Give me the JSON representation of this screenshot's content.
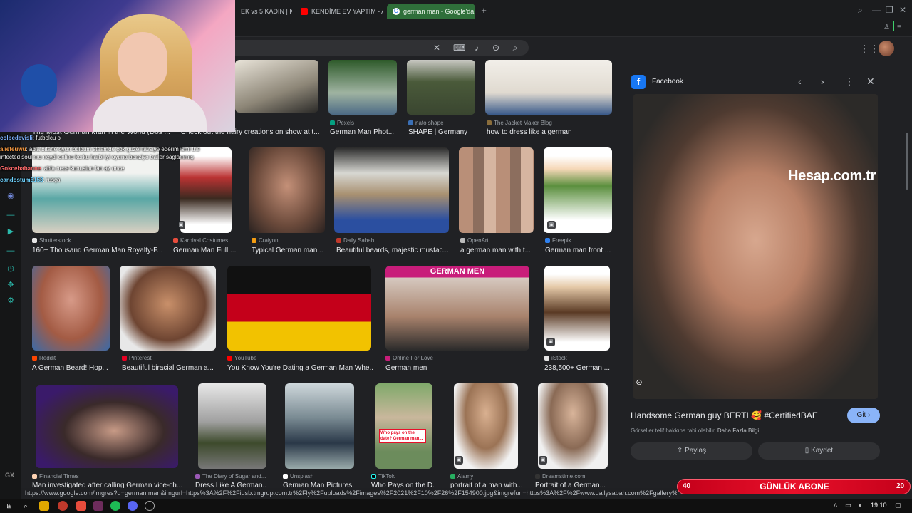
{
  "browser": {
    "tabs": [
      {
        "label": "EK vs 5 KADIN | KIY",
        "icon": "tab-icon"
      },
      {
        "label": "KENDİME EV YAPTIM - A",
        "icon": "youtube-icon"
      },
      {
        "label": "german man - Google'da",
        "icon": "google-icon",
        "active": true
      }
    ],
    "new_tab": "+"
  },
  "search": {
    "clear": "✕",
    "keyboard": "⌨",
    "mic": "🎤",
    "lens": "⊙",
    "search": "⌕"
  },
  "results": {
    "row0": [
      {
        "source": "",
        "caption": "The Most German Man in the World (Dos ..."
      },
      {
        "source": "",
        "caption": "Check out the hairy creations on show at t..."
      },
      {
        "source": "Pexels",
        "caption": "German Man Phot..."
      },
      {
        "source": "nato shape",
        "caption": "SHAPE | Germany"
      },
      {
        "source": "The Jacket Maker Blog",
        "caption": "how to dress like a german"
      }
    ],
    "row1": [
      {
        "source": "Shutterstock",
        "caption": "160+ Thousand German Man Royalty-F..."
      },
      {
        "source": "Karnival Costumes",
        "caption": "German Man Full ..."
      },
      {
        "source": "Craiyon",
        "caption": "Typical German man..."
      },
      {
        "source": "Daily Sabah",
        "caption": "Beautiful beards, majestic mustac..."
      },
      {
        "source": "OpenArt",
        "caption": "a german man with t..."
      },
      {
        "source": "Freepik",
        "caption": "German man front ..."
      }
    ],
    "row2": [
      {
        "source": "Reddit",
        "caption": "A German Beard! Hop..."
      },
      {
        "source": "Pinterest",
        "caption": "Beautiful biracial German a..."
      },
      {
        "source": "YouTube",
        "caption": "You Know You're Dating a German Man Whe..."
      },
      {
        "source": "Online For Love",
        "caption": "German men"
      },
      {
        "source": "iStock",
        "caption": "238,500+ German ..."
      }
    ],
    "row3": [
      {
        "source": "Financial Times",
        "caption": "Man investigated after calling German vice-ch..."
      },
      {
        "source": "The Diary of Sugar and...",
        "caption": "Dress Like A German..."
      },
      {
        "source": "Unsplash",
        "caption": "German Man Pictures..."
      },
      {
        "source": "TikTok",
        "caption": "Who Pays on the D..."
      },
      {
        "source": "Alamy",
        "caption": "portrait of a man with..."
      },
      {
        "source": "Dreamstime.com",
        "caption": "Portrait of a German..."
      }
    ],
    "banner_text": "GERMAN MEN",
    "tiktok_overlay": "Who pays on the date? German man..."
  },
  "preview": {
    "source": "Facebook",
    "watermark": "Hesap.com.tr",
    "title": "Handsome German guy BERTI 🥰 #CertifiedBAE",
    "visit": "Git",
    "copyright": "Görseller telif hakkına tabi olabilir.",
    "learn_more": "Daha Fazla Bilgi",
    "share": "Paylaş",
    "save": "Kaydet"
  },
  "chat": [
    {
      "user": "colbedevisli",
      "msg": ": futbolcu o",
      "color": "#7fb4ff"
    },
    {
      "user": "aliefeuwu",
      "msg": ": abla bitane oyun buldum steamde çok güzel tavsiye ederim ismi the",
      "color": "#ff9f43"
    },
    {
      "user": "",
      "msg": "infected soul mu neydi online korku harbi iyi oyuna benziyo trailer sağlammış",
      "color": "#ffffff"
    },
    {
      "user": "Gokcebabanne",
      "msg": ": abla nece konustun lan az once",
      "color": "#ff6b6b"
    },
    {
      "user": "candostum6153",
      "msg": ": rusça",
      "color": "#6fd3ff"
    }
  ],
  "overlay": {
    "sub_left": "40",
    "sub_label": "GÜNLÜK ABONE",
    "sub_right": "20"
  },
  "status_url": "https://www.google.com/imgres?q=german man&imgurl=https%3A%2F%2Fidsb.tmgrup.com.tr%2Fly%2Fuploads%2Fimages%2F2021%2F10%2F26%2F154900.jpg&imgrefurl=https%3A%2F%2Fwww.dailysabah.com%2Fgallery%2Fbeautiful-beards-majestic-mustaches-compete-at-german-event",
  "taskbar": {
    "time": "19:10",
    "gx": "GX"
  },
  "colors": {
    "accent": "#8ab4f8",
    "tab_active": "#2f6f3a",
    "subscribe_bar": "#e8102a"
  }
}
